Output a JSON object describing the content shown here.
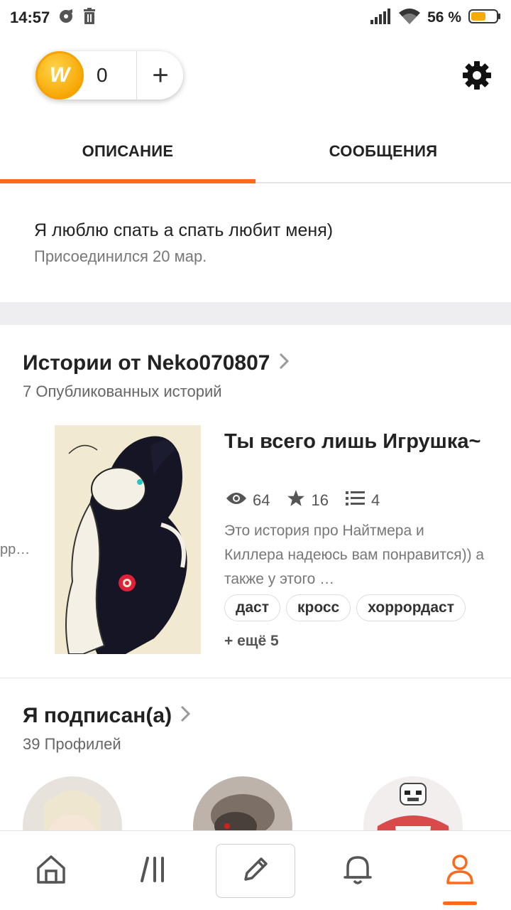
{
  "status_bar": {
    "time": "14:57",
    "battery_percent": "56 %",
    "icons": [
      "music-note-icon",
      "trash-icon",
      "signal-icon",
      "wifi-icon",
      "battery-icon"
    ]
  },
  "header": {
    "coin_count": "0",
    "coin_symbol": "W",
    "add_label": "+",
    "icons": [
      "coin-icon",
      "settings-gear-icon"
    ]
  },
  "tabs": [
    {
      "label": "ОПИСАНИЕ",
      "active": true
    },
    {
      "label": "СООБЩЕНИЯ",
      "active": false
    }
  ],
  "about": {
    "bio": "Я люблю спать а спать любит меня)",
    "joined": "Присоединился 20 мар."
  },
  "stories": {
    "title": "Истории от Neko070807",
    "subtitle": "7 Опубликованных историй",
    "prev_peek": "рр…",
    "item": {
      "title": "Ты всего лишь Игрушка~",
      "views": "64",
      "votes": "16",
      "parts": "4",
      "description": "Это история про Найтмера и Киллера надеюсь вам понравится)) а также у этого …",
      "tags": [
        "даст",
        "кросс",
        "хоррордаст"
      ],
      "more_tags": "+ ещё 5"
    }
  },
  "following": {
    "title": "Я подписан(а)",
    "subtitle": "39 Профилей"
  },
  "bottom_nav": {
    "items": [
      "home-icon",
      "library-icon",
      "write-icon",
      "notifications-icon",
      "profile-icon"
    ],
    "active": "profile-icon",
    "accent": "#ff6a1a"
  }
}
